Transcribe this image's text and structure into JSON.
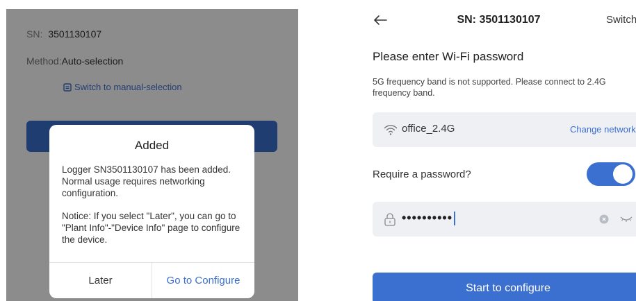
{
  "left": {
    "sn_key": "SN:",
    "sn_value": "3501130107",
    "method_key": "Method:",
    "method_value": "Auto-selection",
    "manual_link": "Switch to manual-selection",
    "dialog": {
      "title": "Added",
      "body1": "Logger SN3501130107 has been added. Normal usage requires networking configuration.",
      "body2": "Notice: If you select \"Later\", you can go to \"Plant Info\"-\"Device Info\" page to configure the device.",
      "later": "Later",
      "go": "Go to Configure"
    }
  },
  "right": {
    "title": "SN: 3501130107",
    "switch_label": "Switch",
    "heading": "Please enter Wi-Fi password",
    "note": "5G frequency band is not supported. Please connect to 2.4G frequency band.",
    "network_name": "office_2.4G",
    "change_network": "Change network",
    "require_label": "Require a password?",
    "require_on": true,
    "password_mask": "••••••••••",
    "start_button": "Start to configure"
  },
  "colors": {
    "accent": "#3b6fd0",
    "field_bg": "#eef0f3"
  },
  "icons": [
    "back-arrow-icon",
    "wifi-icon",
    "lock-icon",
    "clear-icon",
    "eye-closed-icon",
    "switch-mode-icon"
  ]
}
